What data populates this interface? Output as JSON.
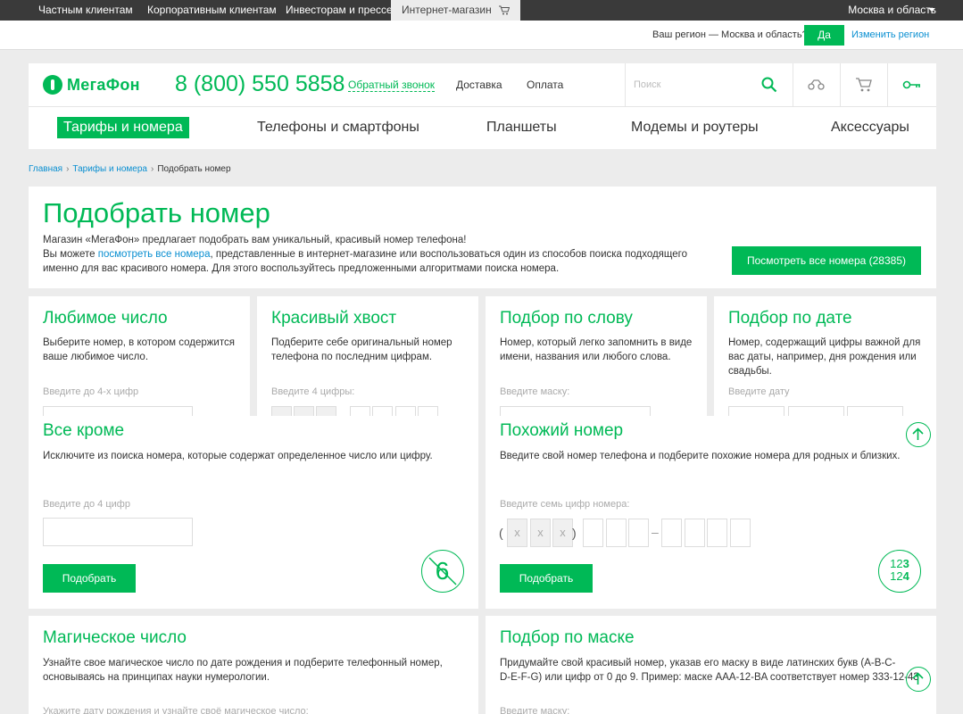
{
  "top_tabs": [
    "Частным клиентам",
    "Корпоративным клиентам",
    "Инвесторам и прессе",
    "Интернет-магазин"
  ],
  "top_region": "Москва и область",
  "region_bar": {
    "question": "Ваш регион — Москва и область?",
    "yes": "Да",
    "change": "Изменить регион"
  },
  "header": {
    "logo": "МегаФон",
    "phone": "8 (800) 550 5858",
    "callback": "Обратный звонок",
    "nav": [
      "Доставка",
      "Оплата"
    ],
    "search_placeholder": "Поиск",
    "icons": [
      "search-icon",
      "compare-icon",
      "cart-icon",
      "key-icon"
    ]
  },
  "menu": [
    "Тарифы и номера",
    "Телефоны и смартфоны",
    "Планшеты",
    "Модемы и роутеры",
    "Аксессуары"
  ],
  "breadcrumbs": [
    "Главная",
    "Тарифы и номера",
    "Подобрать номер"
  ],
  "intro": {
    "title": "Подобрать номер",
    "line1": "Магазин «МегаФон» предлагает подобрать вам уникальный, красивый номер телефона!",
    "line2_pre": "Вы можете ",
    "line2_link": "посмотреть все номера",
    "line2_post": ", представленные в интернет-магазине или воспользоваться один из способов поиска подходящего",
    "line3": "именно для вас красивого номера. Для этого воспользуйтесь предложенными алгоритмами поиска номера.",
    "button": "Посмотреть все номера (28385)"
  },
  "cards": {
    "favorite": {
      "title": "Любимое число",
      "desc1": "Выберите номер, в котором содержится",
      "desc2": "ваше любимое число.",
      "label": "Введите до 4-х цифр"
    },
    "tail": {
      "title": "Красивый хвост",
      "desc1": "Подберите себе оригинальный номер",
      "desc2": "телефона по последним цифрам.",
      "label": "Введите 4 цифры:"
    },
    "word": {
      "title": "Подбор по слову",
      "desc1": "Номер, который легко запомнить в виде",
      "desc2": "имени, названия или любого слова.",
      "label": "Введите маску:"
    },
    "date": {
      "title": "Подбор по дате",
      "desc1": "Номер, содержащий цифры важной для",
      "desc2": "вас даты, например, дня рождения или",
      "desc3": "свадьбы.",
      "label": "Введите дату"
    },
    "except": {
      "title": "Все кроме",
      "desc1": "Исключите из поиска номера, которые содержат определенное число или цифру.",
      "label": "Введите до 4 цифр",
      "button": "Подобрать",
      "badge": "6"
    },
    "similar": {
      "title": "Похожий номер",
      "desc1": "Введите свой номер телефона и подберите похожие номера для родных и близких.",
      "label": "Введите семь цифр номера:",
      "mask": "x",
      "button": "Подобрать",
      "badge_line1_a": "12",
      "badge_line1_b": "3",
      "badge_line2_a": "12",
      "badge_line2_b": "4"
    },
    "magic": {
      "title": "Магическое число",
      "desc1": "Узнайте свое магическое число по дате рождения и подберите телефонный номер,",
      "desc2": "основываясь на принципах науки нумерологии.",
      "label": "Укажите дату рождения и узнайте своё магическое число:"
    },
    "mask": {
      "title": "Подбор по маске",
      "desc1": "Придумайте свой красивый номер, указав его маску в виде латинских букв (A-B-C-",
      "desc2": "D-E-F-G) или цифр от 0 до 9. Пример: маске AAA-12-BA соответствует номер 333-12-43",
      "label": "Введите маску:"
    }
  },
  "colors": {
    "brand": "#00b956",
    "link": "#0a8fd1",
    "topbar": "#3a3a3a"
  }
}
